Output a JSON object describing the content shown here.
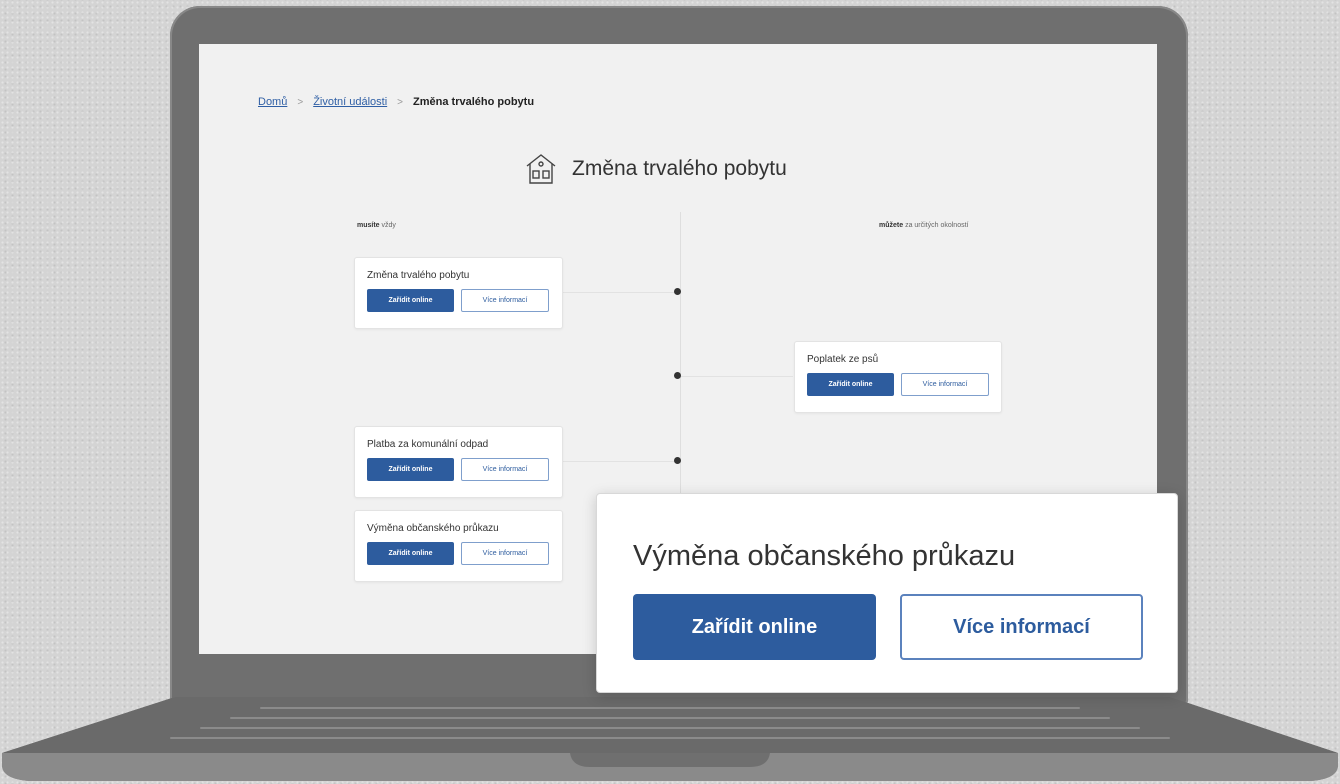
{
  "breadcrumb": {
    "home": "Domů",
    "section": "Životní události",
    "current": "Změna trvalého pobytu",
    "separator": ">"
  },
  "page": {
    "title": "Změna trvalého pobytu",
    "icon": "house-icon"
  },
  "columns": {
    "left_bold": "musíte",
    "left_rest": " vždy",
    "right_bold": "můžete",
    "right_rest": " za určitých okolností"
  },
  "cards": [
    {
      "title": "Změna trvalého pobytu",
      "primary": "Zařídit online",
      "secondary": "Více informací"
    },
    {
      "title": "Poplatek ze psů",
      "primary": "Zařídit online",
      "secondary": "Více informací"
    },
    {
      "title": "Platba za komunální odpad",
      "primary": "Zařídit online",
      "secondary": "Více informací"
    },
    {
      "title": "Výměna občanského průkazu",
      "primary": "Zařídit online",
      "secondary": "Více informací"
    }
  ],
  "zoom": {
    "title": "Výměna občanského průkazu",
    "primary": "Zařídit online",
    "secondary": "Více informací"
  },
  "colors": {
    "primary": "#2d5c9e",
    "link": "#2f5fa5"
  }
}
